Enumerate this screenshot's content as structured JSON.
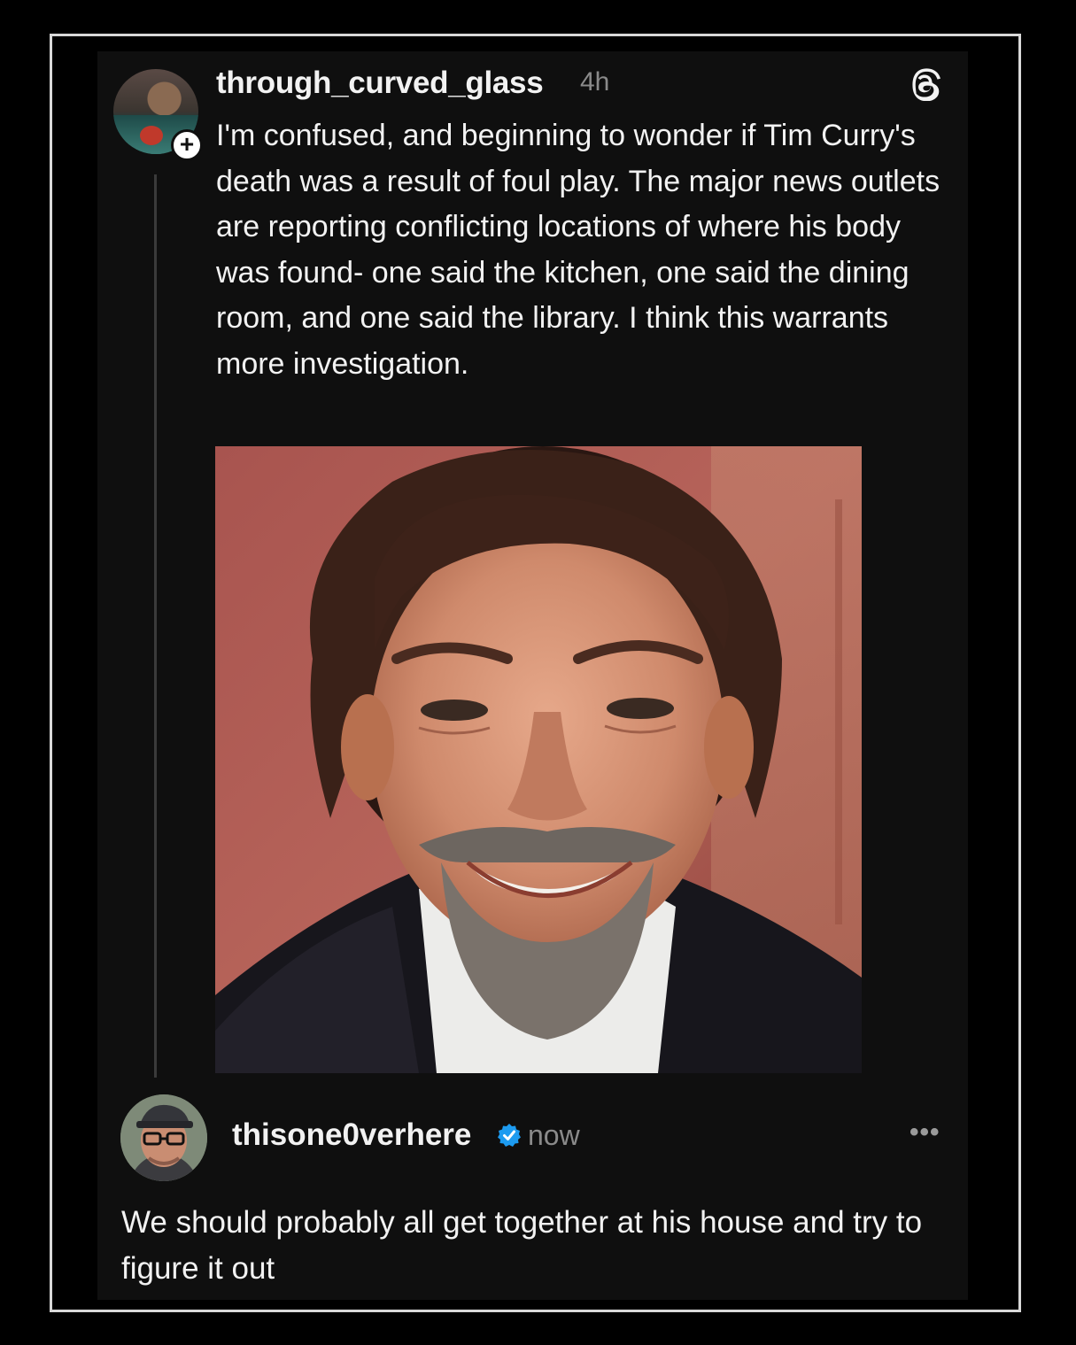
{
  "post": {
    "username": "through_curved_glass",
    "time": "4h",
    "text": "I'm confused, and beginning to wonder if Tim Curry's death was a result of foul play. The major news outlets are reporting conflicting locations of where his body was found- one said the kitchen, one said the dining room, and one said the library. I think this warrants more investigation.",
    "follow_badge": "+",
    "logo_icon": "threads-logo-icon"
  },
  "reply": {
    "username": "thisone0verhere",
    "verified": true,
    "time": "now",
    "more_label": "•••",
    "text": "We should probably all get together at his house and try to figure it out"
  },
  "colors": {
    "background": "#000000",
    "card": "#0f0f0f",
    "text": "#f2f2f2",
    "muted": "#8a8a8a",
    "verified": "#1d9bf0"
  }
}
